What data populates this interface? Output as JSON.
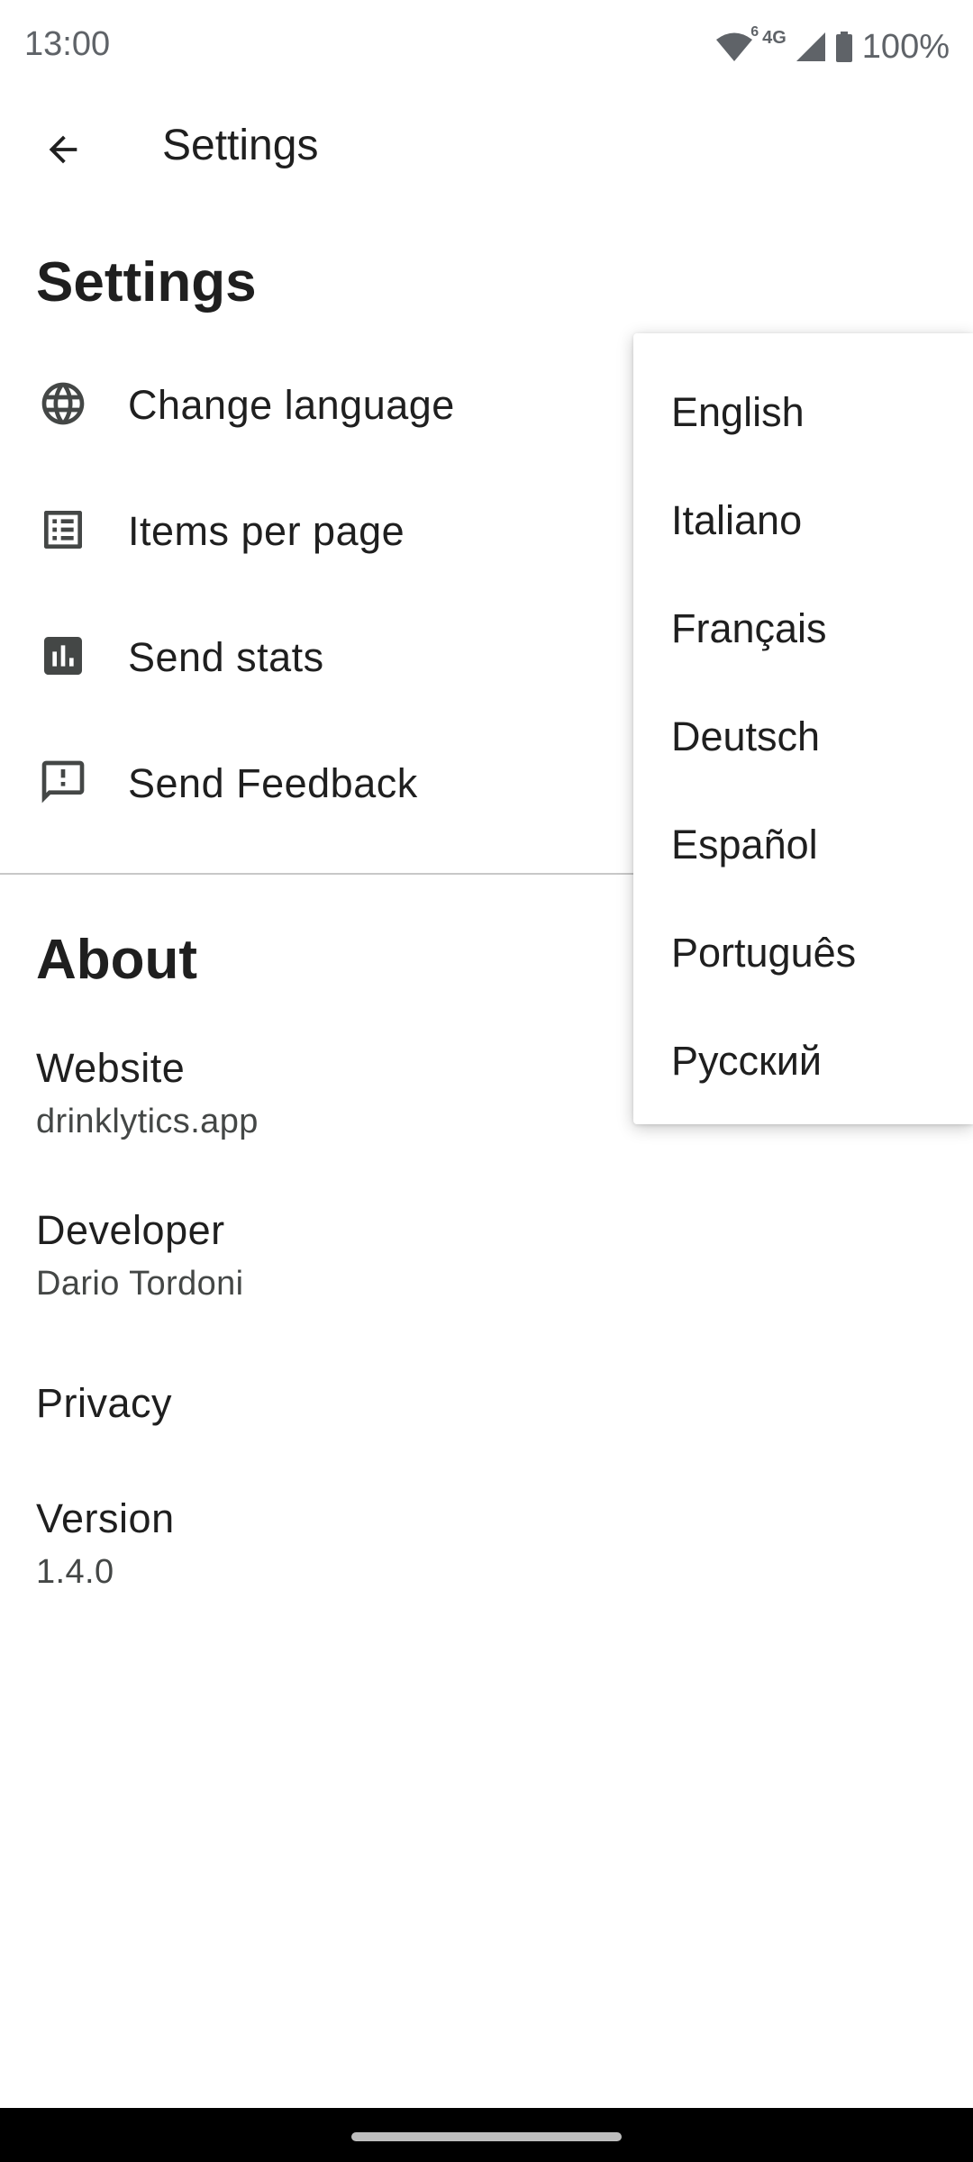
{
  "status_bar": {
    "time": "13:00",
    "wifi_badge": "6",
    "network_type": "4G",
    "battery": "100%",
    "icons": [
      "wifi-icon",
      "signal-icon",
      "battery-icon"
    ]
  },
  "app_bar": {
    "title": "Settings",
    "back_icon": "arrow-back-icon"
  },
  "settings_section": {
    "title": "Settings",
    "items": [
      {
        "label": "Change language",
        "icon": "globe-icon"
      },
      {
        "label": "Items per page",
        "icon": "list-icon"
      },
      {
        "label": "Send stats",
        "icon": "bar-chart-icon"
      },
      {
        "label": "Send Feedback",
        "icon": "feedback-icon"
      }
    ]
  },
  "about_section": {
    "title": "About",
    "items": [
      {
        "label": "Website",
        "value": "drinklytics.app"
      },
      {
        "label": "Developer",
        "value": "Dario Tordoni"
      },
      {
        "label": "Privacy",
        "value": ""
      },
      {
        "label": "Version",
        "value": "1.4.0"
      }
    ]
  },
  "language_menu": {
    "options": [
      "English",
      "Italiano",
      "Français",
      "Deutsch",
      "Español",
      "Português",
      "Русский"
    ]
  },
  "colors": {
    "text_primary": "#1f1f1f",
    "text_secondary": "#444746",
    "divider": "#c8c8c8",
    "nav_bar": "#000000"
  }
}
